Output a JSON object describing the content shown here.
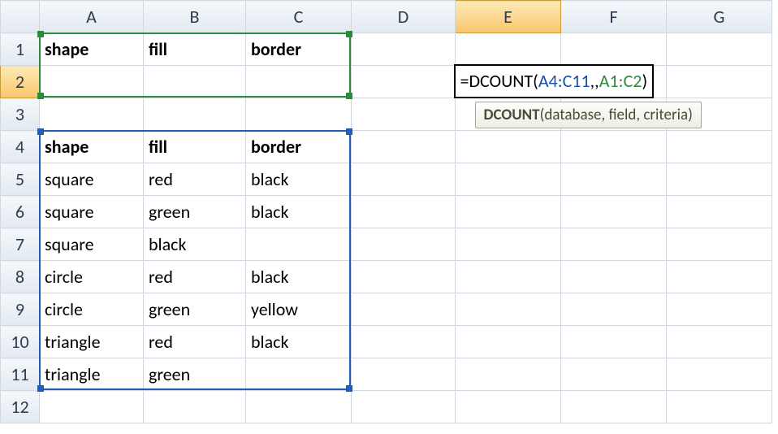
{
  "columns": [
    "A",
    "B",
    "C",
    "D",
    "E",
    "F",
    "G"
  ],
  "rows": [
    "1",
    "2",
    "3",
    "4",
    "5",
    "6",
    "7",
    "8",
    "9",
    "10",
    "11",
    "12"
  ],
  "activeColumn": "E",
  "activeRow": "2",
  "cells": {
    "A1": {
      "text": "shape",
      "bold": true
    },
    "B1": {
      "text": "fill",
      "bold": true
    },
    "C1": {
      "text": "border",
      "bold": true
    },
    "A4": {
      "text": "shape",
      "bold": true
    },
    "B4": {
      "text": "fill",
      "bold": true
    },
    "C4": {
      "text": "border",
      "bold": true
    },
    "A5": {
      "text": "square"
    },
    "B5": {
      "text": "red"
    },
    "C5": {
      "text": "black"
    },
    "A6": {
      "text": "square"
    },
    "B6": {
      "text": "green"
    },
    "C6": {
      "text": "black"
    },
    "A7": {
      "text": "square"
    },
    "B7": {
      "text": "black"
    },
    "A8": {
      "text": "circle"
    },
    "B8": {
      "text": "red"
    },
    "C8": {
      "text": "black"
    },
    "A9": {
      "text": "circle"
    },
    "B9": {
      "text": "green"
    },
    "C9": {
      "text": "yellow"
    },
    "A10": {
      "text": "triangle"
    },
    "B10": {
      "text": "red"
    },
    "C10": {
      "text": "black"
    },
    "A11": {
      "text": "triangle"
    },
    "B11": {
      "text": "green"
    }
  },
  "formula": {
    "prefix": "=DCOUNT(",
    "arg1": "A4:C11",
    "sep1": ",,",
    "arg2": "A1:C2",
    "suffix": ")"
  },
  "tooltip": {
    "fn": "DCOUNT",
    "sig": "(database, field, criteria)"
  },
  "ranges": {
    "blue": {
      "from": "A4",
      "to": "C11"
    },
    "green": {
      "from": "A1",
      "to": "C2"
    }
  }
}
